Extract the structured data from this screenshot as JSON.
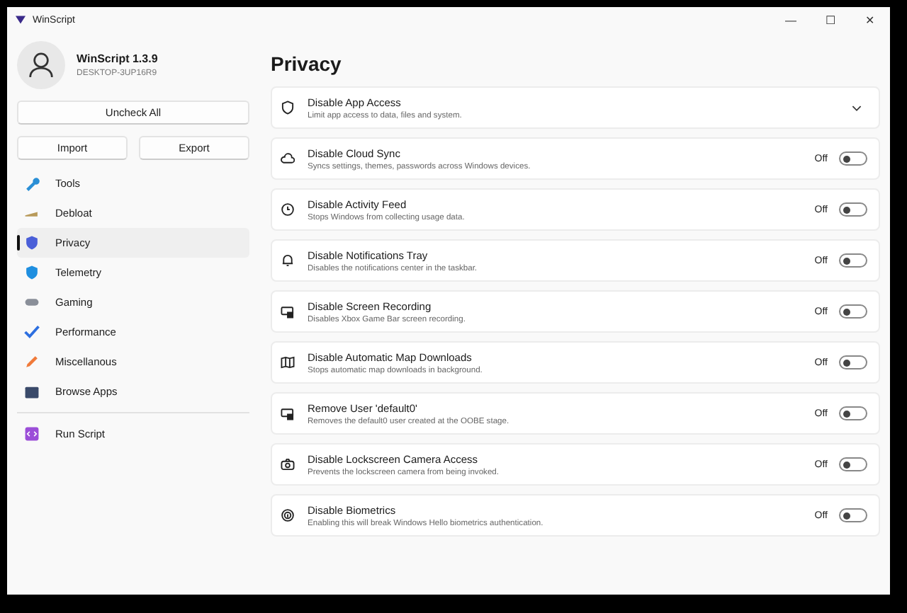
{
  "window": {
    "title": "WinScript",
    "controls": [
      "—",
      "☐",
      "✕"
    ]
  },
  "profile": {
    "name": "WinScript 1.3.9",
    "machine": "DESKTOP-3UP16R9"
  },
  "buttons": {
    "uncheck_all": "Uncheck All",
    "import": "Import",
    "export": "Export"
  },
  "sidebar": {
    "items": [
      {
        "label": "Tools",
        "selected": false
      },
      {
        "label": "Debloat",
        "selected": false
      },
      {
        "label": "Privacy",
        "selected": true
      },
      {
        "label": "Telemetry",
        "selected": false
      },
      {
        "label": "Gaming",
        "selected": false
      },
      {
        "label": "Performance",
        "selected": false
      },
      {
        "label": "Miscellanous",
        "selected": false
      },
      {
        "label": "Browse Apps",
        "selected": false
      }
    ],
    "footer_item": {
      "label": "Run Script",
      "selected": false
    }
  },
  "page": {
    "title": "Privacy",
    "settings": [
      {
        "kind": "expander",
        "title": "Disable App Access",
        "description": "Limit app access to data, files and system.",
        "expanded": false
      },
      {
        "kind": "toggle",
        "title": "Disable Cloud Sync",
        "description": "Syncs settings, themes, passwords across Windows devices.",
        "state_label": "Off",
        "on": false
      },
      {
        "kind": "toggle",
        "title": "Disable Activity Feed",
        "description": "Stops Windows from collecting usage data.",
        "state_label": "Off",
        "on": false
      },
      {
        "kind": "toggle",
        "title": "Disable Notifications Tray",
        "description": "Disables the notifications center in the taskbar.",
        "state_label": "Off",
        "on": false
      },
      {
        "kind": "toggle",
        "title": "Disable Screen Recording",
        "description": "Disables Xbox Game Bar screen recording.",
        "state_label": "Off",
        "on": false
      },
      {
        "kind": "toggle",
        "title": "Disable Automatic Map Downloads",
        "description": "Stops automatic map downloads in background.",
        "state_label": "Off",
        "on": false
      },
      {
        "kind": "toggle",
        "title": "Remove User 'default0'",
        "description": "Removes the default0 user created at the OOBE stage.",
        "state_label": "Off",
        "on": false
      },
      {
        "kind": "toggle",
        "title": "Disable Lockscreen Camera Access",
        "description": "Prevents the lockscreen camera from being invoked.",
        "state_label": "Off",
        "on": false
      },
      {
        "kind": "toggle",
        "title": "Disable Biometrics",
        "description": "Enabling this will break Windows Hello biometrics authentication.",
        "state_label": "Off",
        "on": false
      }
    ]
  }
}
